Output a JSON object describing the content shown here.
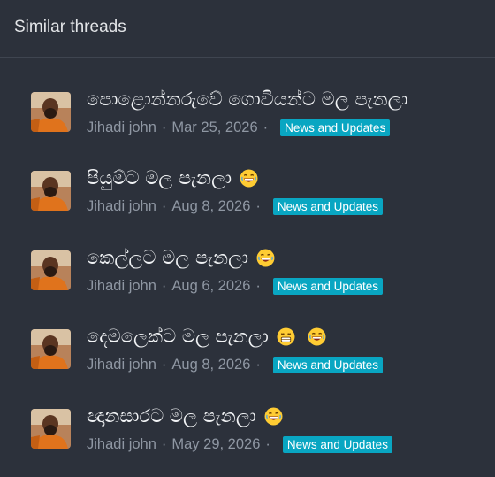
{
  "header": {
    "title": "Similar threads"
  },
  "threads": [
    {
      "title": "පොළොන්නරුවේ ගොවියන්ට මල පැනලා",
      "author": "Jihadi john",
      "date": "Mar 25, 2026",
      "badge": "News and Updates",
      "emojis": []
    },
    {
      "title": "පියුම්ට මල පැනලා",
      "author": "Jihadi john",
      "date": "Aug 8, 2026",
      "badge": "News and Updates",
      "emojis": [
        "laughing-face"
      ]
    },
    {
      "title": "කෙල්ලට මල පැනලා",
      "author": "Jihadi john",
      "date": "Aug 6, 2026",
      "badge": "News and Updates",
      "emojis": [
        "laughing-face"
      ]
    },
    {
      "title": "දෙමලෙක්ට මල පැනලා",
      "author": "Jihadi john",
      "date": "Aug 8, 2026",
      "badge": "News and Updates",
      "emojis": [
        "grinning-face",
        "laughing-face"
      ]
    },
    {
      "title": "ඥානසාරට මල පැනලා",
      "author": "Jihadi john",
      "date": "May 29, 2026",
      "badge": "News and Updates",
      "emojis": [
        "laughing-face"
      ]
    }
  ],
  "separator": "·",
  "colors": {
    "badge": "#09a6c2",
    "background": "#2c313b"
  }
}
